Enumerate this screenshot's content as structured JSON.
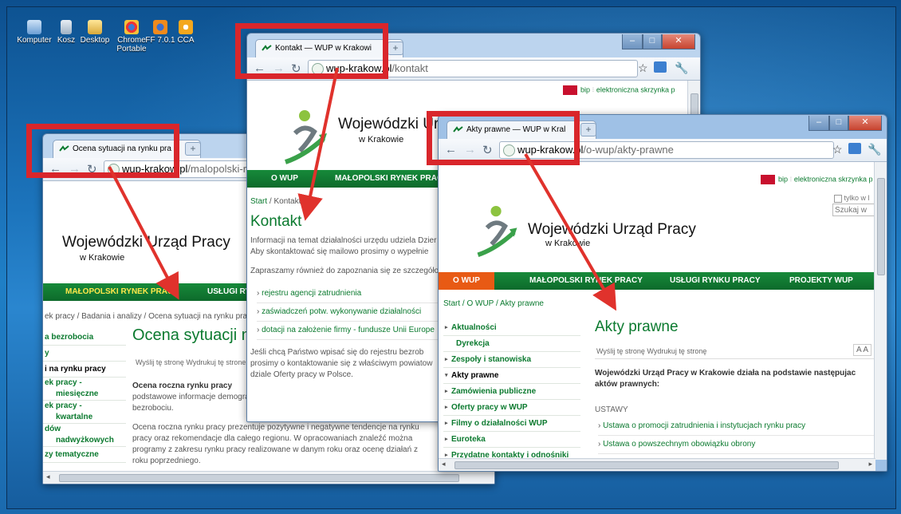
{
  "desktop": {
    "icons": [
      {
        "label": "Komputer",
        "icon": "computer-icon"
      },
      {
        "label": "Kosz",
        "icon": "recycle-bin-icon"
      },
      {
        "label": "Desktop",
        "icon": "folder-icon"
      },
      {
        "label": "Chrome Portable",
        "icon": "chrome-portable-icon"
      },
      {
        "label": "FF 7.0.1",
        "icon": "firefox-icon"
      },
      {
        "label": "CCA",
        "icon": "cca-icon"
      }
    ]
  },
  "window_left": {
    "tab_title": "Ocena sytuacji na rynku pra",
    "url_domain": "wup-krakow.pl",
    "url_path": "/malopolski-r",
    "site_name": "Wojewódzki Urząd Pracy",
    "site_sub": "w Krakowie",
    "nav": [
      "MAŁOPOLSKI RYNEK PRACY",
      "USŁUGI RYNK"
    ],
    "breadcrumb": "ek pracy / Badania i analizy / Ocena sytuacji na rynku pracy",
    "heading": "Ocena sytuacji n",
    "tools": "Wyślij tę stronę   Wydrukuj tę strone",
    "side": [
      "a bezrobocia",
      "y",
      "i na rynku pracy",
      "ek pracy -",
      "miesięczne",
      "ek pracy -",
      "kwartalne",
      "dów",
      "nadwyżkowych",
      "zy tematyczne"
    ],
    "para1": "Ocena roczna rynku pracy to o podstawowe informacje demograf bezrobociu.",
    "para1_bold": "Ocena roczna rynku pracy",
    "para2": "Ocena roczna rynku pracy prezentuje pozytywne i negatywne tendencje na rynku pracy oraz rekomendacje dla całego regionu. W opracowaniach znaleźć można programy z zakresu rynku pracy realizowane w danym roku oraz ocenę działań z roku poprzedniego."
  },
  "window_middle": {
    "tab_title": "Kontakt — WUP w Krakowi",
    "url_domain": "wup-krakow.pl",
    "url_path": "/kontakt",
    "bip_text": "bip",
    "eskrzynka": "elektroniczna skrzynka p",
    "site_name": "Wojewódzki Urz",
    "site_sub": "w Krakowie",
    "nav": [
      "O WUP",
      "MAŁOPOLSKI RYNEK PRAC"
    ],
    "breadcrumb_start": "Start",
    "breadcrumb_current": "Kontakt",
    "heading": "Kontakt",
    "intro1": "Informacji na temat działalności urzędu udziela Dzier",
    "intro2": "Aby skontaktować się mailowo prosimy o wypełnie",
    "intro3": "Zapraszamy również do zapoznania się ze szczegóło",
    "links": [
      "rejestru agencji zatrudnienia",
      "zaświadczeń potw. wykonywanie działalności",
      "dotacji na założenie firmy - fundusze Unii Europe"
    ],
    "outro1": "Jeśli chcą Państwo wpisać się do rejestru bezrob",
    "outro2": "prosimy o kontaktowanie się z właściwym powiatow",
    "outro3": "dziale Oferty pracy w Polsce."
  },
  "window_right": {
    "tab_title": "Akty prawne — WUP w Kral",
    "url_domain": "wup-krakow.pl",
    "url_path": "/o-wup/akty-prawne",
    "bip_text": "bip",
    "eskrzynka": "elektroniczna skrzynka p",
    "checkbox_label": "tylko w l",
    "search_placeholder": "Szukaj w",
    "site_name": "Wojewódzki Urząd Pracy",
    "site_sub": "w Krakowie",
    "nav": [
      "O WUP",
      "MAŁOPOLSKI RYNEK PRACY",
      "USŁUGI RYNKU PRACY",
      "PROJEKTY WUP"
    ],
    "breadcrumb": "Start / O WUP / Akty prawne",
    "side": [
      "Aktualności",
      "Dyrekcja",
      "Zespoły i stanowiska",
      "Akty prawne",
      "Zamówienia publiczne",
      "Oferty pracy w WUP",
      "Filmy o działalności WUP",
      "Euroteka",
      "Przydatne kontakty i odnośniki"
    ],
    "heading": "Akty prawne",
    "tools": "Wyślij tę stronę   Wydrukuj tę stronę",
    "font_sizes": "A A",
    "lead": "Wojewódzki Urząd Pracy w Krakowie działa na podstawie następujac aktów prawnych:",
    "section": "USTAWY",
    "laws": [
      "Ustawa o promocji zatrudnienia i instytucjach rynku pracy",
      "Ustawa o powszechnym obowiązku obrony"
    ]
  },
  "colors": {
    "accent_green": "#0b7a2f",
    "annotation_red": "#d9262b",
    "desktop_blue": "#1a6fb7"
  }
}
